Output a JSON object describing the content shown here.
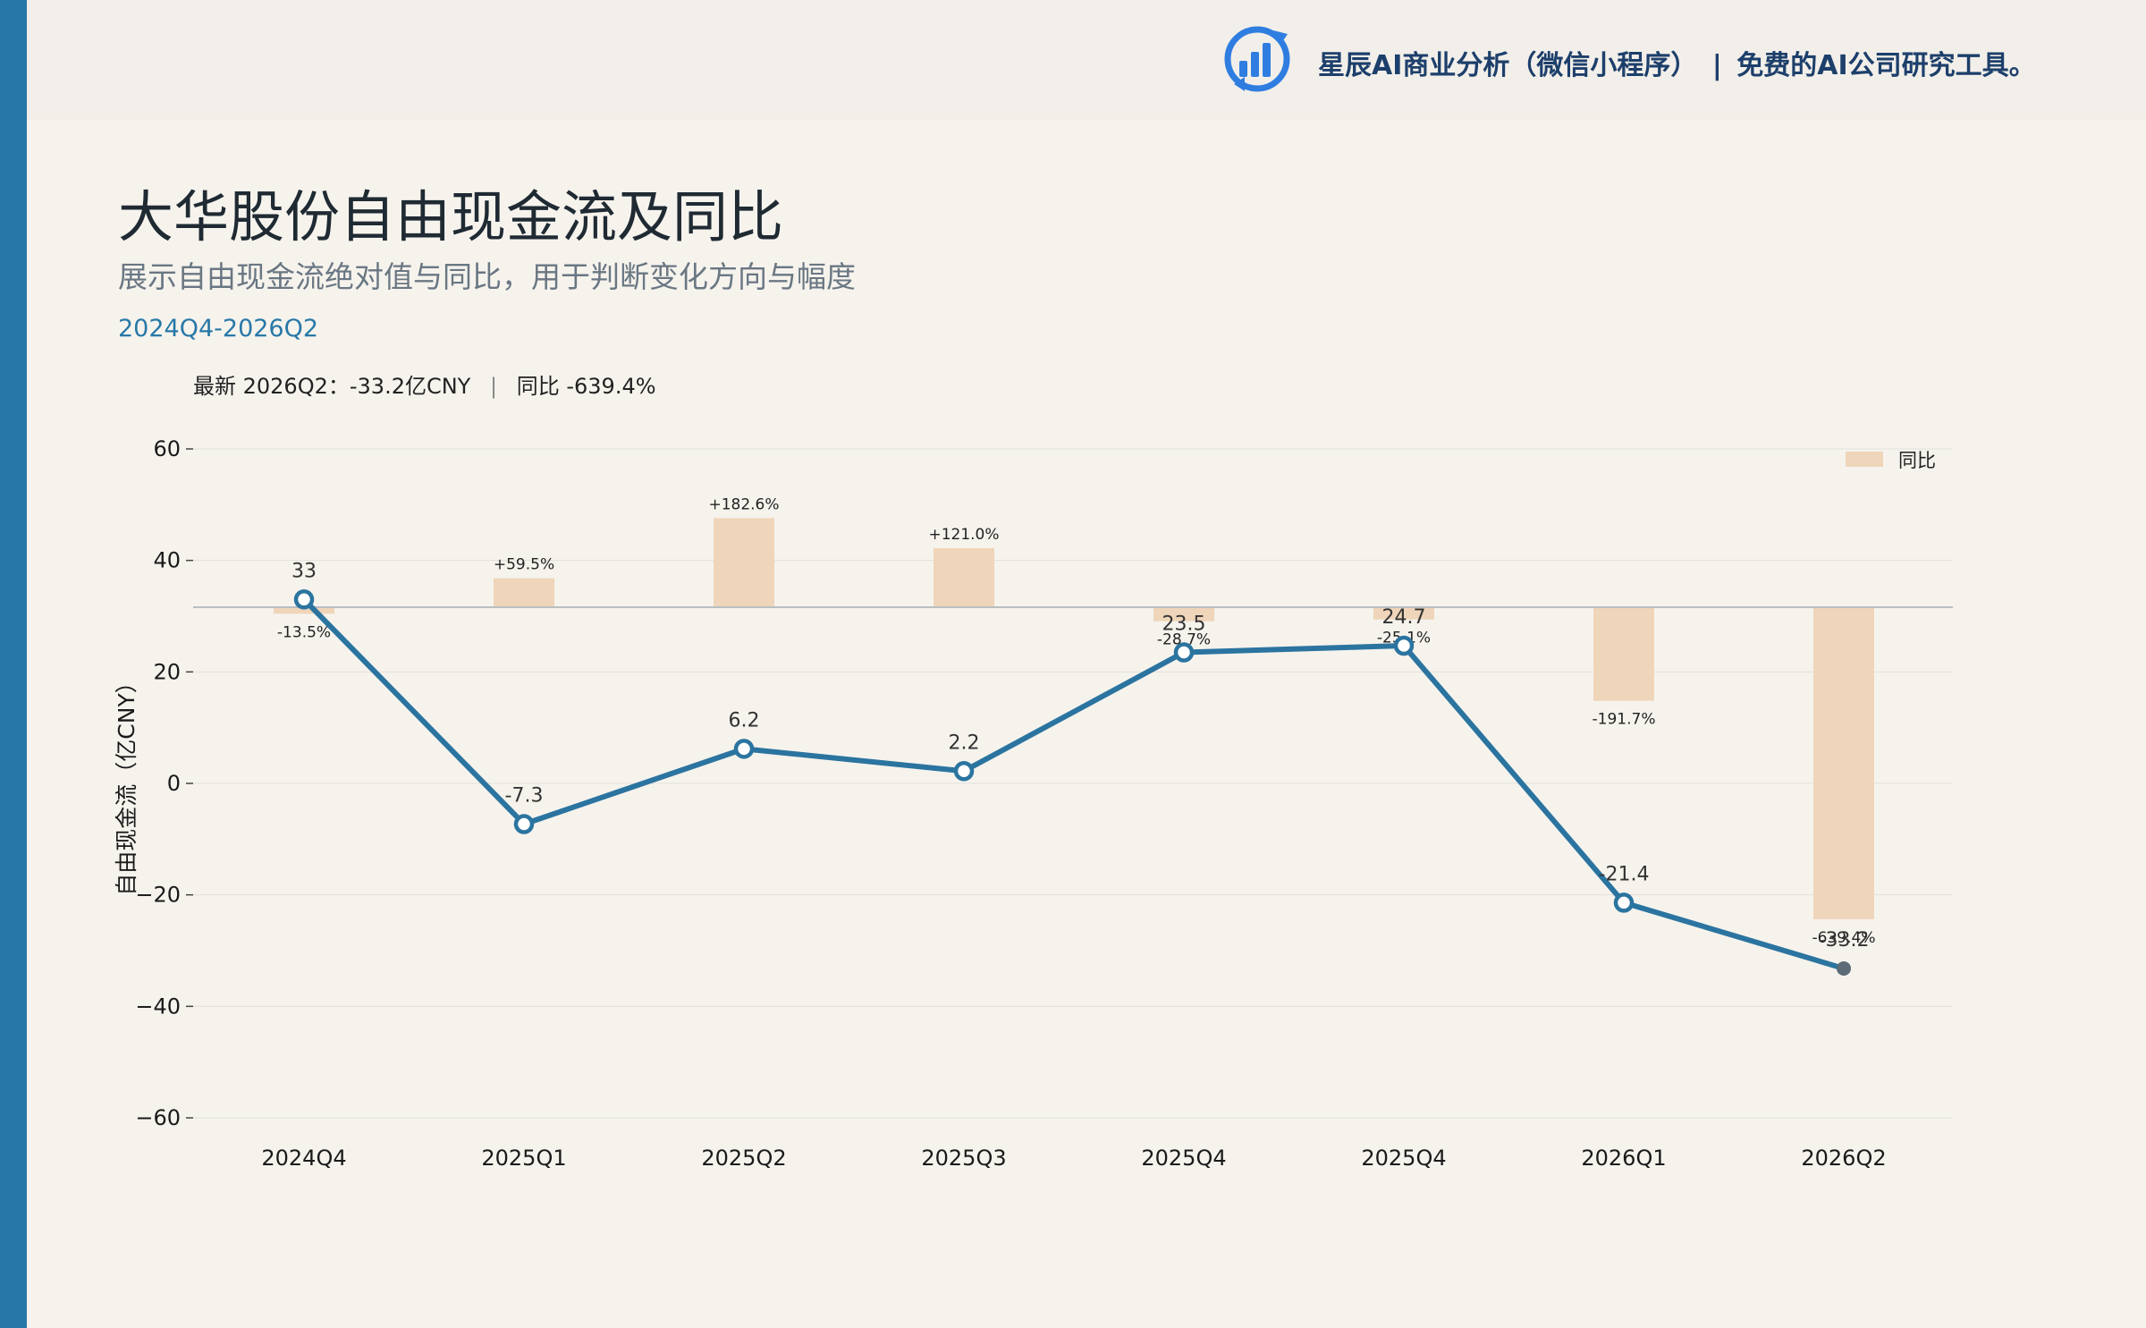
{
  "banner": {
    "app_name": "星辰AI商业分析（微信小程序）",
    "separator": "|",
    "tagline": "免费的AI公司研究工具。"
  },
  "header": {
    "title": "大华股份自由现金流及同比",
    "subtitle": "展示自由现金流绝对值与同比，用于判断变化方向与幅度",
    "period": "2024Q4-2026Q2"
  },
  "summary": {
    "latest": "最新 2026Q2：-33.2亿CNY",
    "separator": "|",
    "yoy": "同比 -639.4%"
  },
  "colors": {
    "accent": "#2878a7",
    "line": "#2b74a0",
    "bar": "#efd5b9",
    "background": "#f6f3ed",
    "last_point": "#5b6b77"
  },
  "chart_data": {
    "type": "bar+line",
    "categories": [
      "2024Q4",
      "2025Q1",
      "2025Q2",
      "2025Q3",
      "2025Q4",
      "2025Q4",
      "2026Q1",
      "2026Q2"
    ],
    "series": [
      {
        "type": "line",
        "values": [
          33,
          -7.3,
          6.2,
          2.2,
          23.5,
          24.7,
          -21.4,
          -33.2
        ],
        "labels": [
          "33",
          "-7.3",
          "6.2",
          "2.2",
          "23.5",
          "24.7",
          "-21.4",
          "-33.2"
        ]
      },
      {
        "name": "同比",
        "type": "bar",
        "values": [
          -13.5,
          59.5,
          182.6,
          121.0,
          -28.7,
          -25.1,
          -191.7,
          -639.4
        ],
        "labels": [
          "-13.5%",
          "+59.5%",
          "+182.6%",
          "+121.0%",
          "-28.7%",
          "-25.1%",
          "-191.7%",
          "-639.4%"
        ]
      }
    ],
    "ylabel": "自由现金流（亿CNY）",
    "yticks": [
      "60",
      "40",
      "20",
      "0",
      "−20",
      "−40",
      "−60"
    ],
    "ytick_values": [
      60,
      40,
      20,
      0,
      -20,
      -40,
      -60
    ],
    "ylim": [
      -60,
      60
    ],
    "grid": true,
    "legend": {
      "position": "top-right",
      "entries": [
        "同比"
      ]
    }
  }
}
